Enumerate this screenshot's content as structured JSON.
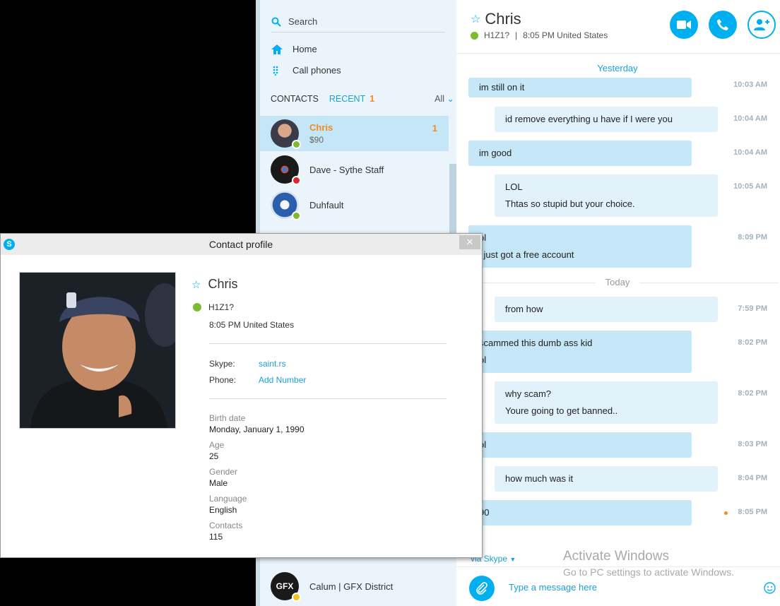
{
  "sidebar": {
    "search_label": "Search",
    "nav": [
      {
        "label": "Home"
      },
      {
        "label": "Call phones"
      }
    ],
    "tabs": {
      "contacts": "CONTACTS",
      "recent": "RECENT",
      "recent_count": "1",
      "filter": "All"
    },
    "contacts": [
      {
        "name": "Chris",
        "sub": "$90",
        "badge": "1",
        "status": "online"
      },
      {
        "name": "Dave - Sythe Staff",
        "status": "busy"
      },
      {
        "name": "Duhfault",
        "status": "online"
      },
      {
        "name": "Calum | GFX District",
        "status": "away"
      }
    ]
  },
  "chat": {
    "name": "Chris",
    "mood": "H1Z1?",
    "local_time": "8:05 PM United States",
    "day_yesterday": "Yesterday",
    "day_today": "Today",
    "messages": [
      {
        "lines": [
          "im still on it"
        ],
        "time": "10:03 AM",
        "from": "them"
      },
      {
        "lines": [
          "id remove everything u have if I were you"
        ],
        "time": "10:04 AM",
        "from": "me"
      },
      {
        "lines": [
          "im good"
        ],
        "time": "10:04 AM",
        "from": "them"
      },
      {
        "lines": [
          "LOL",
          "Thtas so stupid but your choice."
        ],
        "time": "10:05 AM",
        "from": "me"
      },
      {
        "lines": [
          "ol",
          "i just got a free account"
        ],
        "time": "8:09 PM",
        "from": "them"
      },
      {
        "lines": [
          "from how"
        ],
        "time": "7:59 PM",
        "from": "me"
      },
      {
        "lines": [
          "scammed this dumb ass kid",
          "ol"
        ],
        "time": "8:02 PM",
        "from": "them"
      },
      {
        "lines": [
          "why scam?",
          "Youre going to get banned.."
        ],
        "time": "8:02 PM",
        "from": "me"
      },
      {
        "lines": [
          "ol"
        ],
        "time": "8:03 PM",
        "from": "them"
      },
      {
        "lines": [
          "how much was it"
        ],
        "time": "8:04 PM",
        "from": "me"
      },
      {
        "lines": [
          "90"
        ],
        "time": "8:05 PM",
        "from": "them"
      }
    ],
    "via_skype": "via Skype",
    "compose_placeholder": "Type a message here",
    "watermark_title": "Activate Windows",
    "watermark_sub": "Go to PC settings to activate Windows."
  },
  "profile": {
    "window_title": "Contact profile",
    "close_label": "✕",
    "name": "Chris",
    "mood": "H1Z1?",
    "local_time": "8:05 PM United States",
    "skype_label": "Skype:",
    "skype_value": "saint.rs",
    "phone_label": "Phone:",
    "phone_value": "Add Number",
    "details": [
      {
        "label": "Birth date",
        "value": "Monday, January 1, 1990"
      },
      {
        "label": "Age",
        "value": "25"
      },
      {
        "label": "Gender",
        "value": "Male"
      },
      {
        "label": "Language",
        "value": "English"
      },
      {
        "label": "Contacts",
        "value": "115"
      }
    ]
  },
  "colors": {
    "accent": "#00aff0",
    "unread": "#f08c1e",
    "online": "#7dba2f",
    "busy": "#e0242c"
  }
}
